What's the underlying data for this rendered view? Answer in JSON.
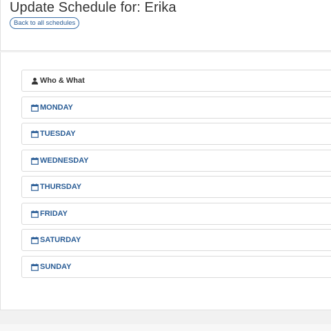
{
  "header": {
    "title": "Update Schedule for: Erika",
    "back_label": "Back to all schedules"
  },
  "sections": {
    "who_what": {
      "label": "Who & What",
      "icon": "user-icon"
    },
    "monday": {
      "label": "MONDAY",
      "icon": "calendar-icon"
    },
    "tuesday": {
      "label": "TUESDAY",
      "icon": "calendar-icon"
    },
    "wednesday": {
      "label": "WEDNESDAY",
      "icon": "calendar-icon"
    },
    "thursday": {
      "label": "THURSDAY",
      "icon": "calendar-icon"
    },
    "friday": {
      "label": "FRIDAY",
      "icon": "calendar-icon"
    },
    "saturday": {
      "label": "SATURDAY",
      "icon": "calendar-icon"
    },
    "sunday": {
      "label": "SUNDAY",
      "icon": "calendar-icon"
    }
  },
  "colors": {
    "accent": "#2a5d96",
    "text_dark": "#333333",
    "border": "#dadada"
  }
}
